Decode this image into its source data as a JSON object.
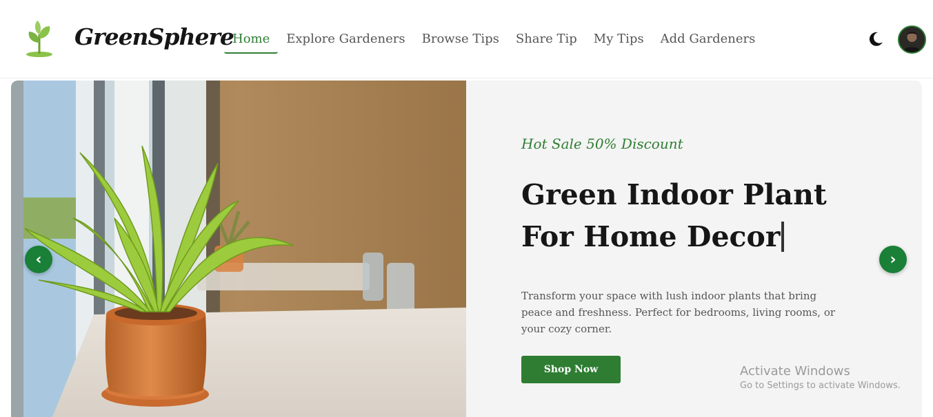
{
  "brand": {
    "name": "GreenSphere",
    "logo_icon": "sprout-icon"
  },
  "nav": {
    "items": [
      {
        "label": "Home",
        "active": true
      },
      {
        "label": "Explore Gardeners",
        "active": false
      },
      {
        "label": "Browse Tips",
        "active": false
      },
      {
        "label": "Share Tip",
        "active": false
      },
      {
        "label": "My Tips",
        "active": false
      },
      {
        "label": "Add Gardeners",
        "active": false
      }
    ],
    "theme_toggle_icon": "moon-icon",
    "avatar_icon": "user-avatar"
  },
  "hero": {
    "tag": "Hot Sale 50% Discount",
    "title": "Green Indoor Plant\nFor Home Decor",
    "description": "Transform your space with lush indoor plants that bring peace and freshness. Perfect for bedrooms, living rooms, or your cozy corner.",
    "cta_label": "Shop Now",
    "prev_arrow": "‹",
    "next_arrow": "›"
  },
  "watermark": {
    "title": "Activate Windows",
    "subtitle": "Go to Settings to activate Windows."
  },
  "colors": {
    "accent": "#2e7d32",
    "arrow_bg": "#1a7f37",
    "hero_bg": "#f4f4f4",
    "text_dark": "#161616",
    "text_muted": "#555555"
  }
}
